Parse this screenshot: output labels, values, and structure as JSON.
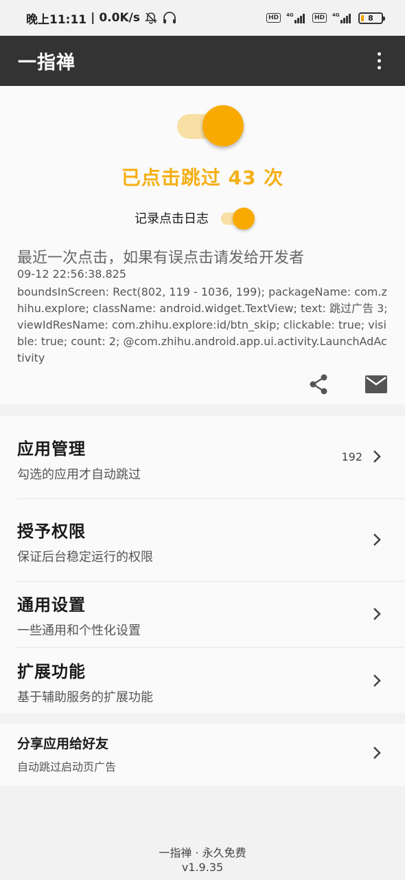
{
  "status_bar": {
    "time": "晚上11:11",
    "separator": "|",
    "net_speed": "0.0K/s",
    "hd1": "HD",
    "sig1": "4G",
    "hd2": "HD",
    "sig2": "4G",
    "battery": "8",
    "icons": [
      "bell-off-icon",
      "headset-icon",
      "signal-icon",
      "battery-icon"
    ]
  },
  "app_bar": {
    "title": "一指禅",
    "menu_icon": "more-vert-icon"
  },
  "main_toggle": {
    "on": true,
    "accent": "#F9AA00"
  },
  "click_count_text": "已点击跳过 43 次",
  "log_toggle": {
    "label": "记录点击日志",
    "on": true
  },
  "recent_click": {
    "title": "最近一次点击，如果有误点击请发给开发者",
    "time": "09-12 22:56:38.825",
    "detail": "boundsInScreen: Rect(802, 119 - 1036, 199); packageName: com.zhihu.explore; className: android.widget.TextView; text: 跳过广告 3; viewIdResName: com.zhihu.explore:id/btn_skip; clickable: true; visible: true; count: 2; @com.zhihu.android.app.ui.activity.LaunchAdActivity",
    "share_icon": "share-icon",
    "mail_icon": "mail-icon"
  },
  "menu": [
    {
      "title": "应用管理",
      "subtitle": "勾选的应用才自动跳过",
      "count": "192"
    },
    {
      "title": "授予权限",
      "subtitle": "保证后台稳定运行的权限"
    },
    {
      "title": "通用设置",
      "subtitle": "一些通用和个性化设置"
    },
    {
      "title": "扩展功能",
      "subtitle": "基于辅助服务的扩展功能"
    }
  ],
  "share_app": {
    "title": "分享应用给好友",
    "subtitle": "自动跳过启动页广告"
  },
  "footer": {
    "line1": "一指禅 · 永久免费",
    "version": "v1.9.35"
  },
  "colors": {
    "app_bar": "#333333",
    "accent": "#F9AA00",
    "count_text": "#F5B016",
    "background": "#F2F2F2"
  }
}
